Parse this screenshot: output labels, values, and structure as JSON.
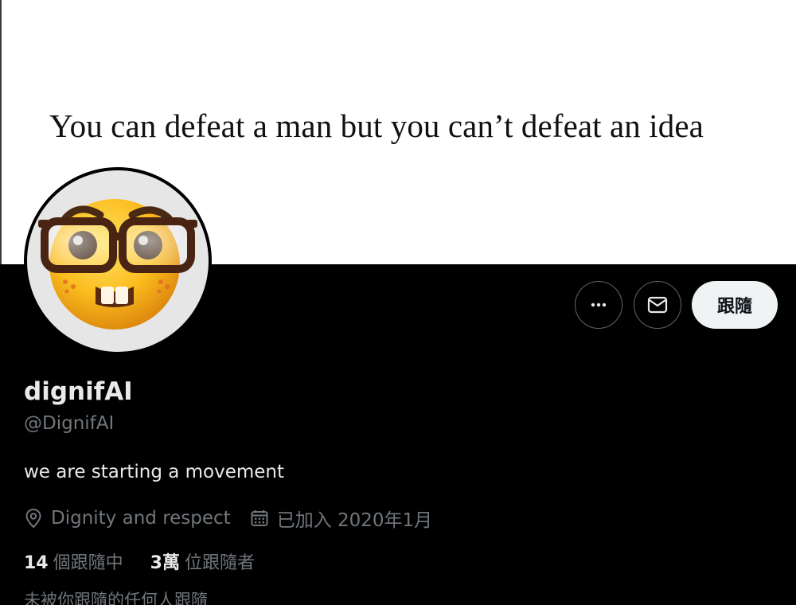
{
  "banner": {
    "quote": "You can defeat a man but you can’t defeat an idea"
  },
  "avatar": {
    "icon": "nerd-face-emoji"
  },
  "actions": {
    "more_icon": "more-dots-icon",
    "message_icon": "mail-icon",
    "follow_label": "跟隨"
  },
  "profile": {
    "display_name": "dignifAI",
    "handle": "@DignifAI",
    "bio": "we are starting a movement",
    "location": "Dignity and respect",
    "location_icon": "location-pin-icon",
    "joined": "已加入 2020年1月",
    "joined_icon": "calendar-icon"
  },
  "stats": {
    "following_count": "14",
    "following_label": "個跟隨中",
    "followers_count": "3萬",
    "followers_label": "位跟隨者"
  },
  "followed_by_note": "未被你跟隨的任何人跟隨",
  "colors": {
    "background": "#000000",
    "banner": "#ffffff",
    "primary_text": "#e7e9ea",
    "secondary_text": "#71767b",
    "follow_button_bg": "#eff3f4",
    "button_border": "#5e676e"
  }
}
